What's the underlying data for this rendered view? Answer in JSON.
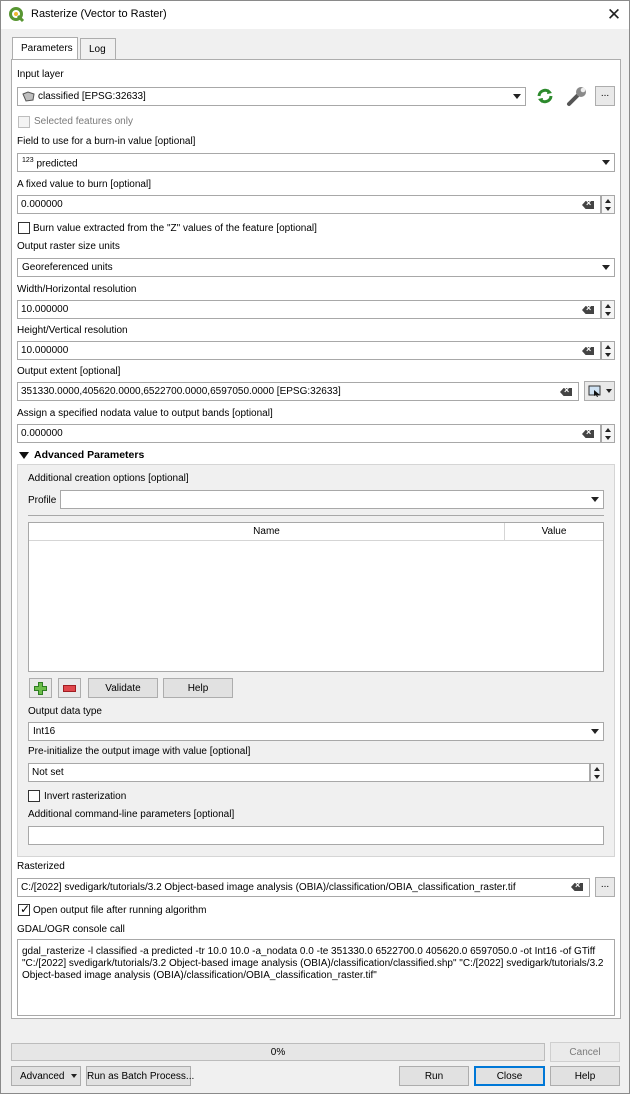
{
  "window": {
    "title": "Rasterize (Vector to Raster)"
  },
  "tabs": [
    "Parameters",
    "Log"
  ],
  "input_layer": {
    "label": "Input layer",
    "value": "classified [EPSG:32633]",
    "selected_only_label": "Selected features only",
    "more_label": "..."
  },
  "burn_field": {
    "label": "Field to use for a burn-in value [optional]",
    "type_prefix": "123",
    "value": "predicted"
  },
  "fixed_value": {
    "label": "A fixed value to burn [optional]",
    "value": "0.000000"
  },
  "burn_z": {
    "label": "Burn value extracted from the \"Z\" values of the feature [optional]"
  },
  "size_units": {
    "label": "Output raster size units",
    "value": "Georeferenced units"
  },
  "width_res": {
    "label": "Width/Horizontal resolution",
    "value": "10.000000"
  },
  "height_res": {
    "label": "Height/Vertical resolution",
    "value": "10.000000"
  },
  "extent": {
    "label": "Output extent [optional]",
    "value": "351330.0000,405620.0000,6522700.0000,6597050.0000 [EPSG:32633]"
  },
  "nodata": {
    "label": "Assign a specified nodata value to output bands [optional]",
    "value": "0.000000"
  },
  "advanced": {
    "header": "Advanced Parameters",
    "creation_options_label": "Additional creation options [optional]",
    "profile_label": "Profile",
    "profile_value": "",
    "columns": [
      "Name",
      "Value"
    ],
    "validate_label": "Validate",
    "help_label": "Help",
    "data_type_label": "Output data type",
    "data_type_value": "Int16",
    "preinit_label": "Pre-initialize the output image with value [optional]",
    "preinit_value": "Not set",
    "invert_label": "Invert rasterization",
    "cmdline_label": "Additional command-line parameters [optional]",
    "cmdline_value": ""
  },
  "output": {
    "label": "Rasterized",
    "value": "C:/[2022] svedigark/tutorials/3.2 Object-based image analysis (OBIA)/classification/OBIA_classification_raster.tif",
    "more_label": "...",
    "open_label": "Open output file after running algorithm"
  },
  "console": {
    "label": "GDAL/OGR console call",
    "text": "gdal_rasterize -l classified -a predicted -tr 10.0 10.0 -a_nodata 0.0 -te 351330.0 6522700.0 405620.0 6597050.0 -ot Int16 -of GTiff \"C:/[2022] svedigark/tutorials/3.2 Object-based image analysis (OBIA)/classification/classified.shp\" \"C:/[2022] svedigark/tutorials/3.2 Object-based image analysis (OBIA)/classification/OBIA_classification_raster.tif\""
  },
  "progress": {
    "text": "0%",
    "percent": 0
  },
  "footer": {
    "cancel": "Cancel",
    "advanced": "Advanced",
    "batch": "Run as Batch Process...",
    "run": "Run",
    "close": "Close",
    "help": "Help"
  },
  "colors": {
    "accent": "#0078d7",
    "qgis_green": "#589632"
  }
}
